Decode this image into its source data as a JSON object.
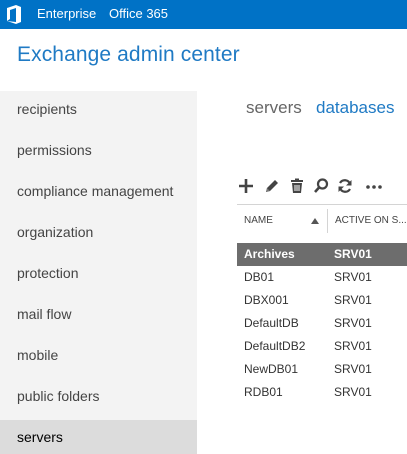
{
  "topbar": {
    "logo_icon": "office-logo-icon",
    "nav": [
      "Enterprise",
      "Office 365"
    ],
    "color": "#0072c6"
  },
  "app": {
    "title": "Exchange admin center"
  },
  "sidebar": {
    "items": [
      {
        "label": "recipients"
      },
      {
        "label": "permissions"
      },
      {
        "label": "compliance management"
      },
      {
        "label": "organization"
      },
      {
        "label": "protection"
      },
      {
        "label": "mail flow"
      },
      {
        "label": "mobile"
      },
      {
        "label": "public folders"
      },
      {
        "label": "servers",
        "selected": true
      }
    ]
  },
  "main": {
    "tabs": [
      {
        "label": "servers",
        "active": false
      },
      {
        "label": "databases",
        "active": true
      }
    ],
    "toolbar": [
      "add-icon",
      "edit-icon",
      "delete-icon",
      "search-icon",
      "refresh-icon",
      "more-icon"
    ],
    "grid": {
      "columns": [
        "NAME",
        "ACTIVE ON S..."
      ],
      "rows": [
        {
          "name": "Archives",
          "server": "SRV01",
          "selected": true
        },
        {
          "name": "DB01",
          "server": "SRV01"
        },
        {
          "name": "DBX001",
          "server": "SRV01"
        },
        {
          "name": "DefaultDB",
          "server": "SRV01"
        },
        {
          "name": "DefaultDB2",
          "server": "SRV01"
        },
        {
          "name": "NewDB01",
          "server": "SRV01"
        },
        {
          "name": "RDB01",
          "server": "SRV01"
        }
      ]
    }
  }
}
